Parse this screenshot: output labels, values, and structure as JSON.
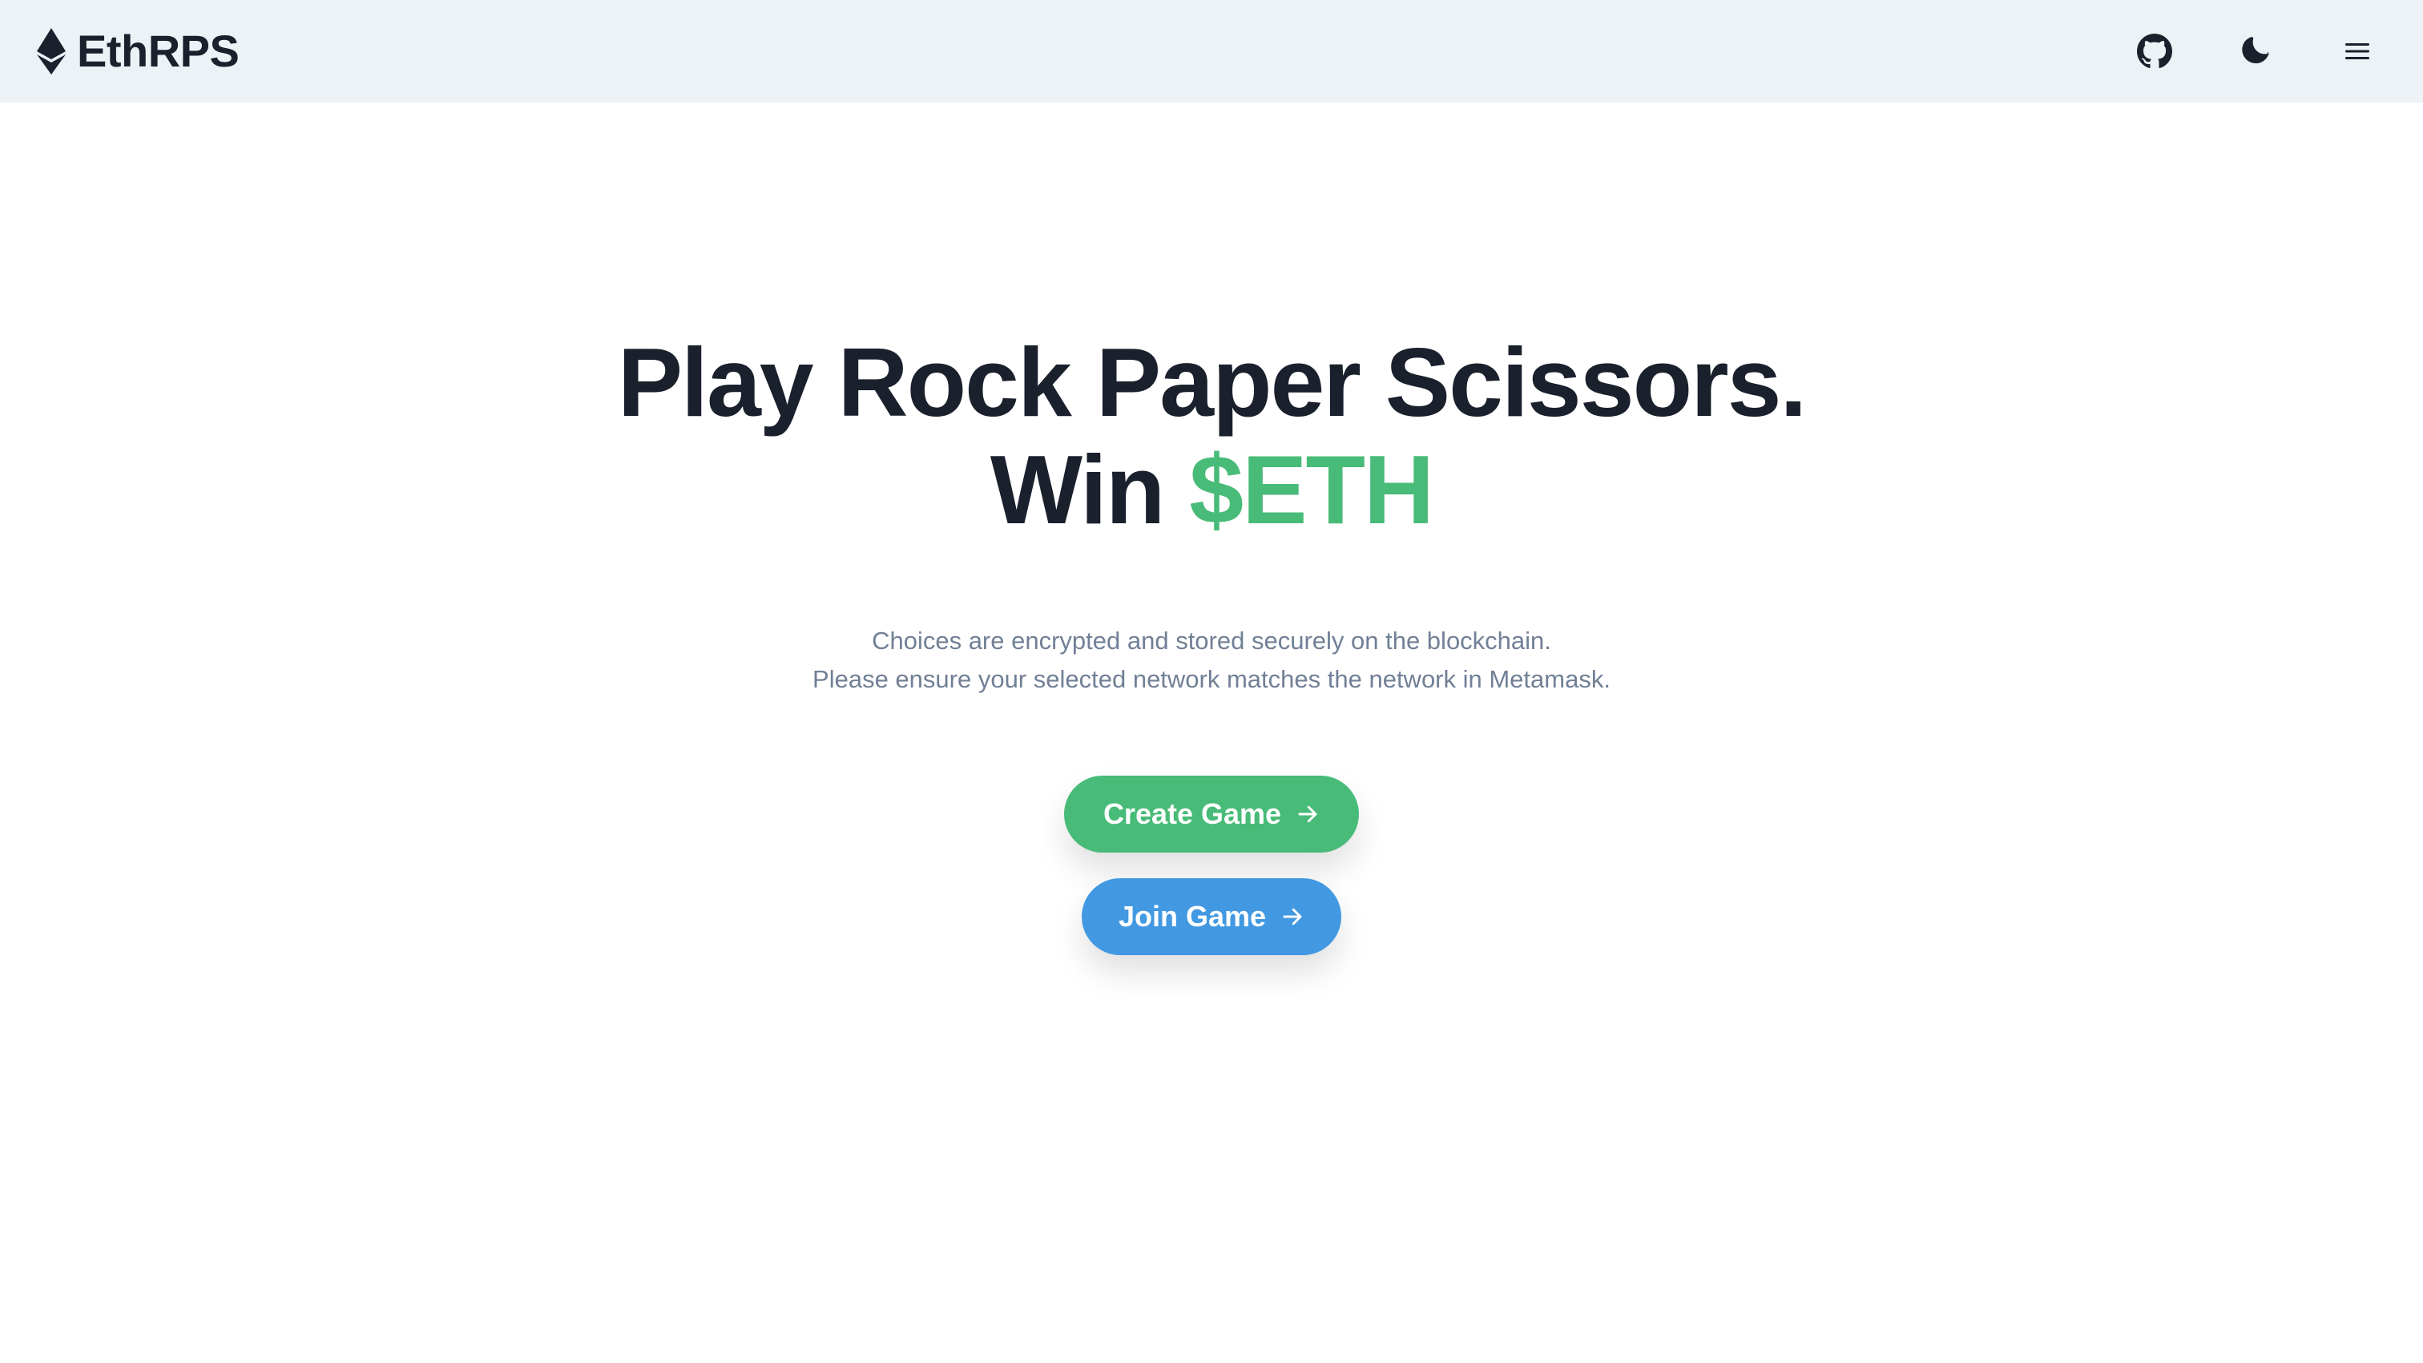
{
  "navbar": {
    "brand": "EthRPS",
    "brand_icon": "ethereum-icon",
    "github_icon": "github-icon",
    "theme_icon": "moon-icon",
    "menu_icon": "hamburger-menu-icon"
  },
  "hero": {
    "headline_line1": "Play Rock Paper Scissors.",
    "headline_line2_prefix": "Win ",
    "headline_line2_accent": "$ETH",
    "description_line1": "Choices are encrypted and stored securely on the blockchain.",
    "description_line2": "Please ensure your selected network matches the network in Metamask."
  },
  "actions": {
    "create_game_label": "Create Game",
    "join_game_label": "Join Game",
    "arrow_icon": "arrow-right-icon"
  },
  "colors": {
    "navbar_bg": "#edf2f7",
    "accent_green": "#48bb78",
    "button_blue": "#4299e1",
    "text_dark": "#1a202c",
    "text_muted": "#718096"
  }
}
